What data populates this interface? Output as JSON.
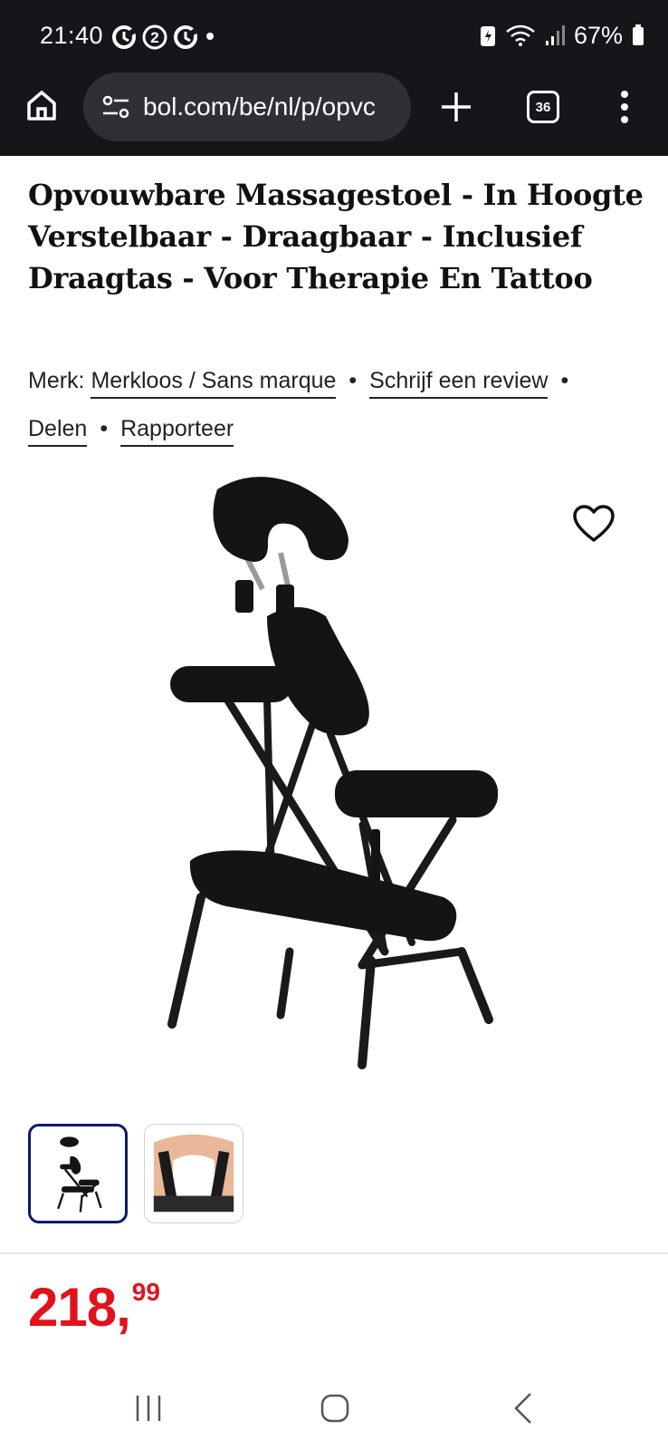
{
  "status_bar": {
    "time": "21:40",
    "battery_percent": "67%",
    "notification_badge": "2"
  },
  "browser": {
    "url": "bol.com/be/nl/p/opvc",
    "tab_count": "36",
    "icons": [
      "home-icon",
      "site-settings-icon",
      "plus-icon",
      "tabs-icon",
      "more-vert-icon"
    ]
  },
  "product": {
    "title": "Opvouwbare Massagestoel - In Hoogte Verstelbaar - Draagbaar - Inclusief Draagtas - Voor Therapie En Tattoo",
    "brand_prefix": "Merk:",
    "brand_link": "Merkloos / Sans marque",
    "review_link": "Schrijf een review",
    "share_link": "Delen",
    "report_link": "Rapporteer",
    "separator": "•",
    "price_main": "218,",
    "price_cents": "99",
    "selected_thumbnail": 0
  },
  "colors": {
    "chrome_bg": "#15151a",
    "url_bg": "#2f3036",
    "price": "#e0131b",
    "thumb_selected_border": "#0a1a6e"
  }
}
